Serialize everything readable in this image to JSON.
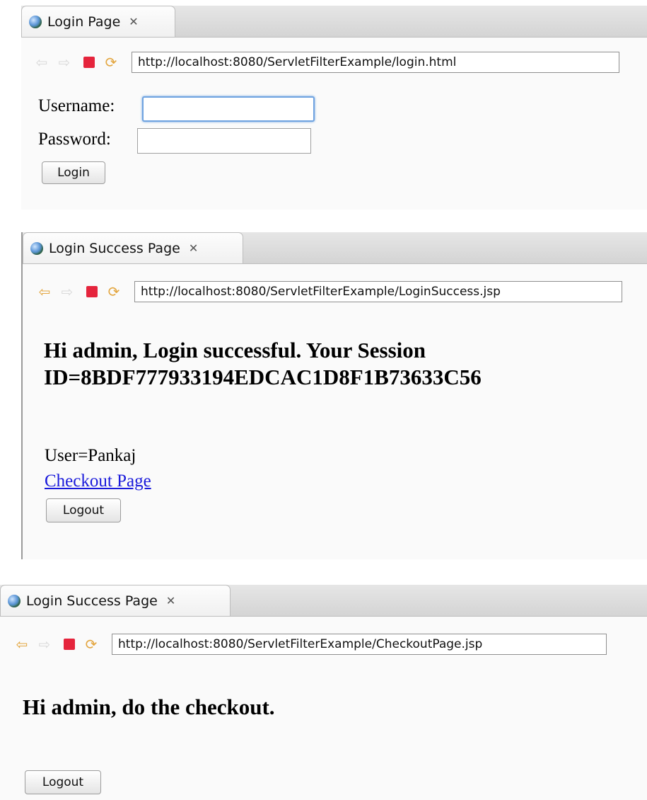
{
  "panels": {
    "login": {
      "tab_title": "Login Page",
      "tab_close": "✕",
      "url": "http://localhost:8080/ServletFilterExample/login.html",
      "back_enabled": false,
      "username_label": "Username:",
      "password_label": "Password:",
      "username_value": "",
      "password_value": "",
      "login_button": "Login"
    },
    "success": {
      "tab_title": "Login Success Page",
      "tab_close": "✕",
      "url": "http://localhost:8080/ServletFilterExample/LoginSuccess.jsp",
      "back_enabled": true,
      "heading_line1": "Hi admin, Login successful. Your Session",
      "heading_line2": "ID=8BDF777933194EDCAC1D8F1B73633C56",
      "user_text": "User=Pankaj",
      "checkout_link": "Checkout Page",
      "logout_button": "Logout"
    },
    "checkout": {
      "tab_title": "Login Success Page",
      "tab_close": "✕",
      "url": "http://localhost:8080/ServletFilterExample/CheckoutPage.jsp",
      "back_enabled": true,
      "heading": "Hi admin, do the checkout.",
      "logout_button": "Logout"
    }
  },
  "icons": {
    "back": "⇦",
    "forward": "⇨",
    "refresh": "⟳"
  },
  "colors": {
    "link": "#1a1adb",
    "stop": "#e5243c",
    "arrow_active": "#e3a640",
    "focus_ring": "#6fa3e0"
  }
}
